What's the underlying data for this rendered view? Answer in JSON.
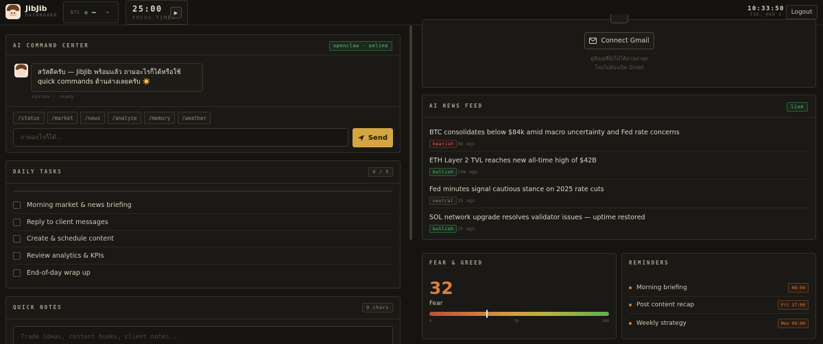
{
  "app": {
    "name": "JibJib",
    "subtitle": "DASHBOARD"
  },
  "ticker": {
    "symbol": "BTC",
    "price": "—",
    "change": "-"
  },
  "focus_timer": {
    "time": "25:00",
    "label": "FOCUS TIMER",
    "play_icon": "▶"
  },
  "clock": {
    "time": "10:33:50",
    "date": "TUE, MAR 3"
  },
  "logout_label": "Logout",
  "command_center": {
    "title": "AI COMMAND CENTER",
    "status_badge": "openclaw · online",
    "message": "สวัสดีครับ — JibJib พร้อมแล้ว ถามอะไรก็ได้หรือใช้ quick commands ด้านล่างเลยครับ ☀️",
    "message_meta": "system · ready",
    "commands": [
      "/status",
      "/market",
      "/news",
      "/analyze",
      "/memory",
      "/weather"
    ],
    "input_placeholder": "ถามอะไรก็ได้...",
    "send_label": "Send"
  },
  "daily_tasks": {
    "title": "DAILY TASKS",
    "count": "0 / 5",
    "progress": 0,
    "items": [
      "Morning market & news briefing",
      "Reply to client messages",
      "Create & schedule content",
      "Review analytics & KPIs",
      "End-of-day wrap up"
    ]
  },
  "quick_notes": {
    "title": "QUICK NOTES",
    "count": "0 chars",
    "placeholder": "Trade ideas, content hooks, client notes..."
  },
  "gmail": {
    "button_label": "Connect Gmail",
    "note_line1": "คู่อีเมลที่ยังไม่ได้อ่านล่าสุด",
    "note_line2": "โดยไม่ต้องเปิด Gmail"
  },
  "news_feed": {
    "title": "AI NEWS FEED",
    "badge": "live",
    "items": [
      {
        "headline": "BTC consolidates below $84k amid macro uncertainty and Fed rate concerns",
        "sentiment": "bearish",
        "time": "8m ago"
      },
      {
        "headline": "ETH Layer 2 TVL reaches new all-time high of $42B",
        "sentiment": "bullish",
        "time": "24m ago"
      },
      {
        "headline": "Fed minutes signal cautious stance on 2025 rate cuts",
        "sentiment": "neutral",
        "time": "1h ago"
      },
      {
        "headline": "SOL network upgrade resolves validator issues — uptime restored",
        "sentiment": "bullish",
        "time": "2h ago"
      }
    ]
  },
  "fear_greed": {
    "title": "FEAR & GREED",
    "value": "32",
    "value_fraction": 0.32,
    "label": "Fear",
    "scale": [
      "0",
      "50",
      "100"
    ]
  },
  "reminders": {
    "title": "REMINDERS",
    "items": [
      {
        "label": "Morning briefing",
        "time": "08:00"
      },
      {
        "label": "Post content recap",
        "time": "Fri 17:00"
      },
      {
        "label": "Weekly strategy",
        "time": "Mon 09:00"
      }
    ]
  },
  "colors": {
    "accent": "#d4a63e",
    "fear": "#d4803c",
    "bullish": "#6fc081",
    "bearish": "#d76a5e"
  }
}
